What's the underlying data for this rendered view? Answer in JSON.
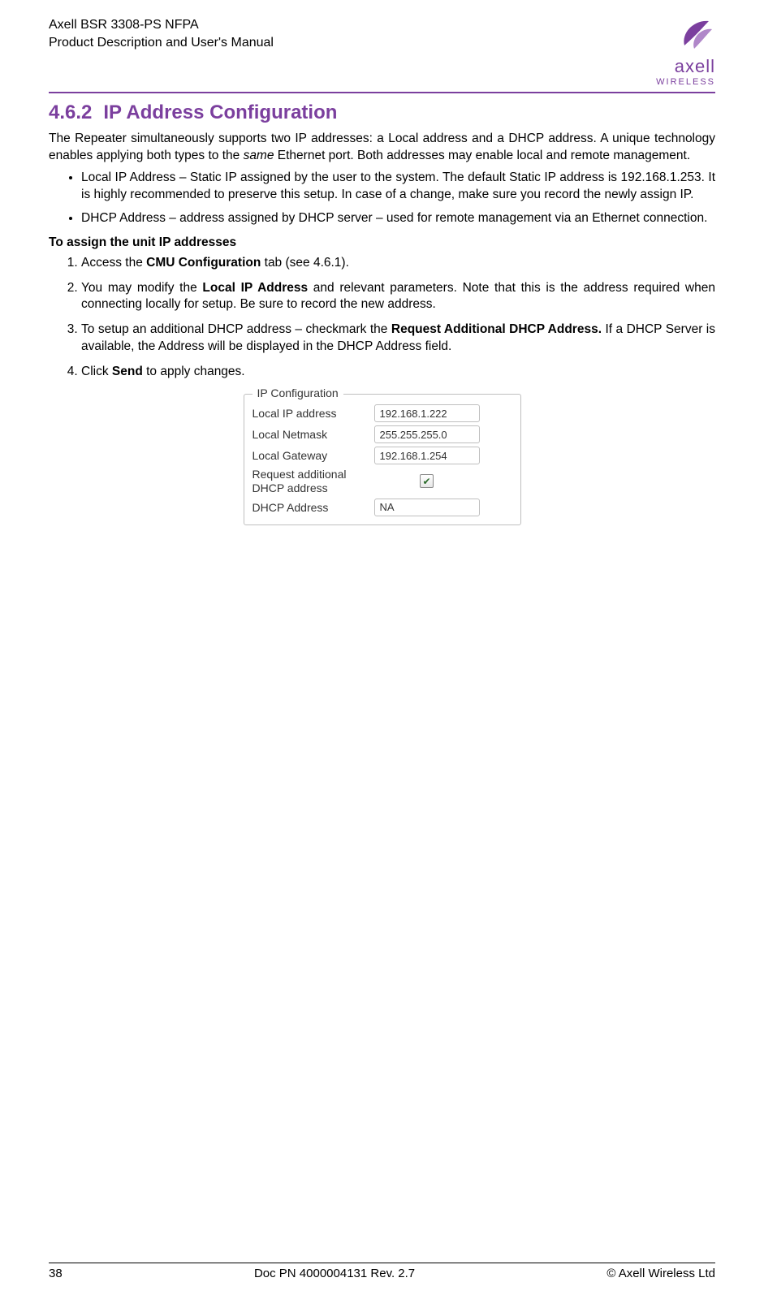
{
  "header": {
    "line1": "Axell BSR 3308-PS NFPA",
    "line2": "Product Description and User's Manual",
    "logo_text": "axell",
    "logo_sub": "WIRELESS"
  },
  "section": {
    "number": "4.6.2",
    "title": "IP Address Configuration"
  },
  "intro": {
    "p1_a": "The Repeater simultaneously supports two IP addresses: a Local address and a DHCP address. A unique technology enables applying both types to the ",
    "p1_same": "same",
    "p1_b": " Ethernet port. Both addresses may enable local and remote management."
  },
  "bullets": [
    "Local IP Address – Static IP assigned by the user to the system. The default Static IP address is 192.168.1.253. It is highly recommended to preserve this setup. In case of a change, make sure you record the newly assign IP.",
    "DHCP Address – address assigned by DHCP server – used for remote management via an Ethernet connection."
  ],
  "subheading": "To assign the unit IP addresses",
  "steps": {
    "s1_a": "Access the ",
    "s1_bold": "CMU Configuration",
    "s1_b": " tab (see  4.6.1).",
    "s2_a": "You may modify the ",
    "s2_bold": "Local IP Address",
    "s2_b": " and relevant parameters. Note that this is the address required when connecting locally for setup. Be sure to record the new address.",
    "s3_a": "To setup an additional DHCP address – checkmark the ",
    "s3_bold": "Request Additional DHCP Address.",
    "s3_b": " If a DHCP Server is available, the Address will be displayed in the DHCP Address field.",
    "s4_a": "Click ",
    "s4_bold": "Send",
    "s4_b": " to apply changes."
  },
  "ip_panel": {
    "legend": "IP Configuration",
    "rows": [
      {
        "label": "Local IP address",
        "value": "192.168.1.222"
      },
      {
        "label": "Local Netmask",
        "value": "255.255.255.0"
      },
      {
        "label": "Local Gateway",
        "value": "192.168.1.254"
      }
    ],
    "request_label": "Request additional DHCP address",
    "request_checked": true,
    "dhcp_label": "DHCP Address",
    "dhcp_value": "NA"
  },
  "footer": {
    "page": "38",
    "doc": "Doc PN 4000004131 Rev. 2.7",
    "copyright": "© Axell Wireless Ltd"
  }
}
